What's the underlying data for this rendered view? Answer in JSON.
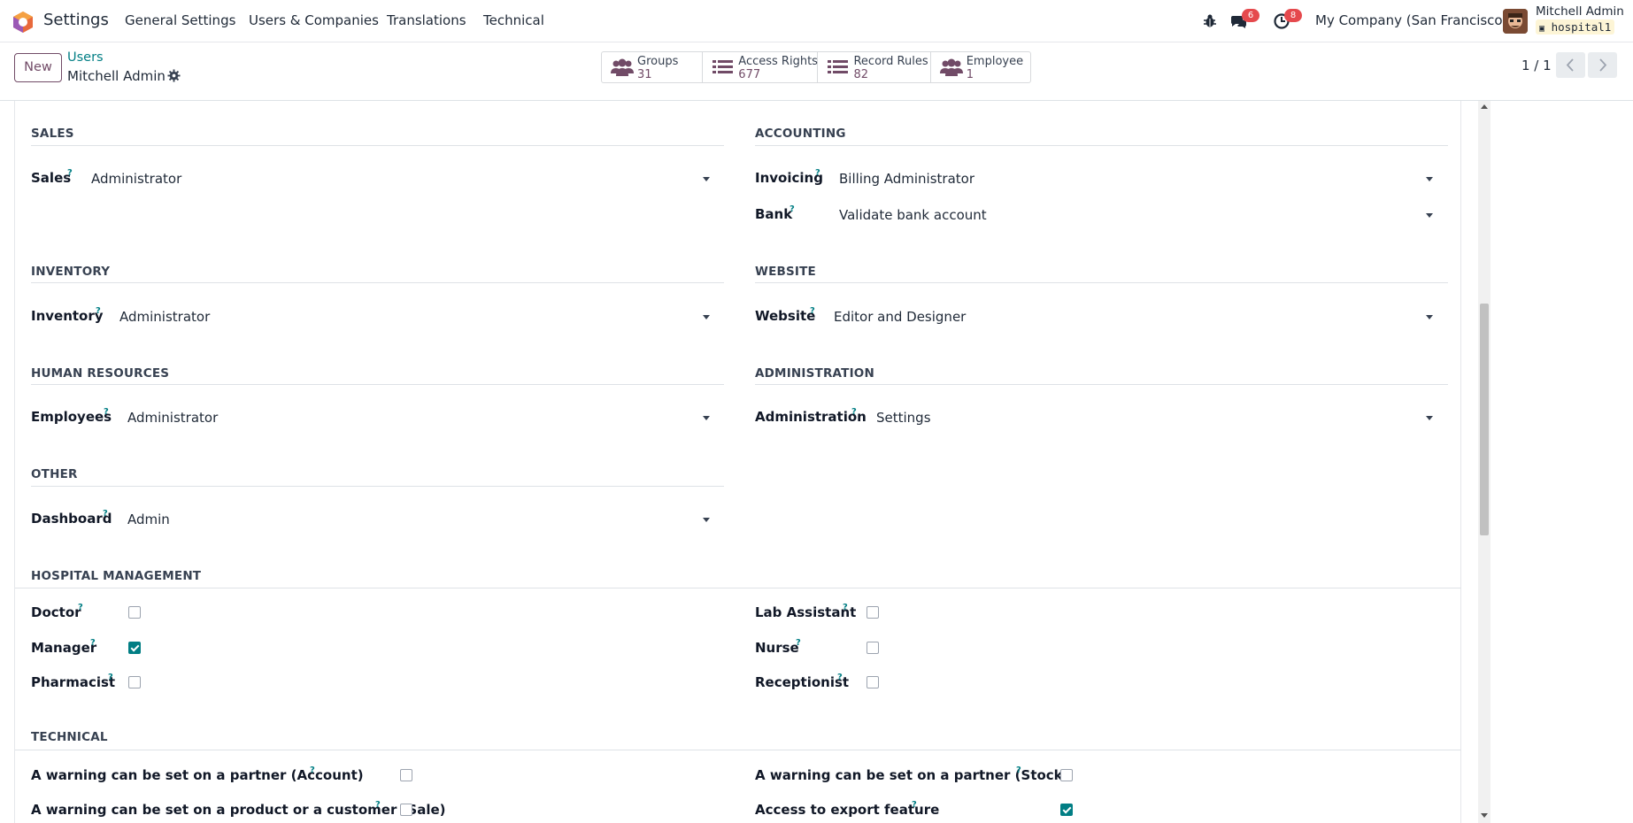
{
  "navbar": {
    "app_name": "Settings",
    "menu": [
      "General Settings",
      "Users & Companies",
      "Translations",
      "Technical"
    ],
    "messages_badge": "6",
    "activities_badge": "8",
    "company": "My Company (San Francisco)",
    "user_name": "Mitchell Admin",
    "database": "hospital1"
  },
  "control": {
    "new_label": "New",
    "breadcrumb_parent": "Users",
    "breadcrumb_current": "Mitchell Admin",
    "stats": [
      {
        "label": "Groups",
        "value": "31",
        "icon": "users-icon"
      },
      {
        "label": "Access Rights",
        "value": "677",
        "icon": "list-icon"
      },
      {
        "label": "Record Rules",
        "value": "82",
        "icon": "list-icon"
      },
      {
        "label": "Employee",
        "value": "1",
        "icon": "users-icon"
      }
    ],
    "pager": "1 / 1"
  },
  "sections": {
    "sales": {
      "title": "SALES",
      "fields": [
        {
          "label": "Sales",
          "value": "Administrator"
        }
      ]
    },
    "accounting": {
      "title": "ACCOUNTING",
      "fields": [
        {
          "label": "Invoicing",
          "value": "Billing Administrator"
        },
        {
          "label": "Bank",
          "value": "Validate bank account"
        }
      ]
    },
    "inventory": {
      "title": "INVENTORY",
      "fields": [
        {
          "label": "Inventory",
          "value": "Administrator"
        }
      ]
    },
    "website": {
      "title": "WEBSITE",
      "fields": [
        {
          "label": "Website",
          "value": "Editor and Designer"
        }
      ]
    },
    "hr": {
      "title": "HUMAN RESOURCES",
      "fields": [
        {
          "label": "Employees",
          "value": "Administrator"
        }
      ]
    },
    "administration": {
      "title": "ADMINISTRATION",
      "fields": [
        {
          "label": "Administration",
          "value": "Settings"
        }
      ]
    },
    "other": {
      "title": "OTHER",
      "fields": [
        {
          "label": "Dashboard",
          "value": "Admin"
        }
      ]
    },
    "hospital": {
      "title": "HOSPITAL MANAGEMENT",
      "checkboxes": [
        {
          "label": "Doctor",
          "checked": false
        },
        {
          "label": "Manager",
          "checked": true
        },
        {
          "label": "Pharmacist",
          "checked": false
        },
        {
          "label": "Lab Assistant",
          "checked": false
        },
        {
          "label": "Nurse",
          "checked": false
        },
        {
          "label": "Receptionist",
          "checked": false
        }
      ]
    },
    "technical": {
      "title": "TECHNICAL",
      "checkboxes": [
        {
          "label": "A warning can be set on a partner (Account)",
          "checked": false
        },
        {
          "label": "A warning can be set on a product or a customer (Sale)",
          "checked": false
        },
        {
          "label": "A warning can be set on a partner (Stock)",
          "checked": false
        },
        {
          "label": "Access to export feature",
          "checked": true
        }
      ]
    }
  },
  "help_mark": "?",
  "colors": {
    "brand": "#714b67",
    "accent": "#017e84",
    "badge": "#e5494d"
  }
}
